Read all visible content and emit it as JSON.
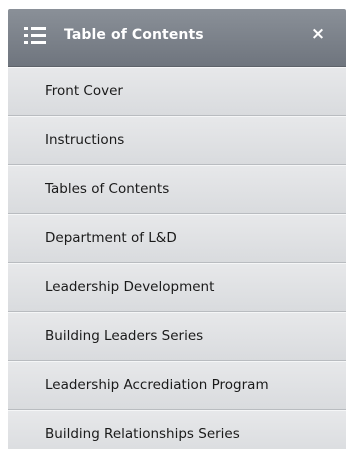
{
  "header": {
    "title": "Table of Contents",
    "close_label": "×",
    "menu_icon": "list-icon",
    "close_icon": "close-icon"
  },
  "items": [
    {
      "label": "Front Cover"
    },
    {
      "label": "Instructions"
    },
    {
      "label": "Tables of Contents"
    },
    {
      "label": "Department of L&D"
    },
    {
      "label": "Leadership Development"
    },
    {
      "label": "Building Leaders Series"
    },
    {
      "label": "Leadership Accrediation Program"
    },
    {
      "label": "Building Relationships Series"
    }
  ]
}
